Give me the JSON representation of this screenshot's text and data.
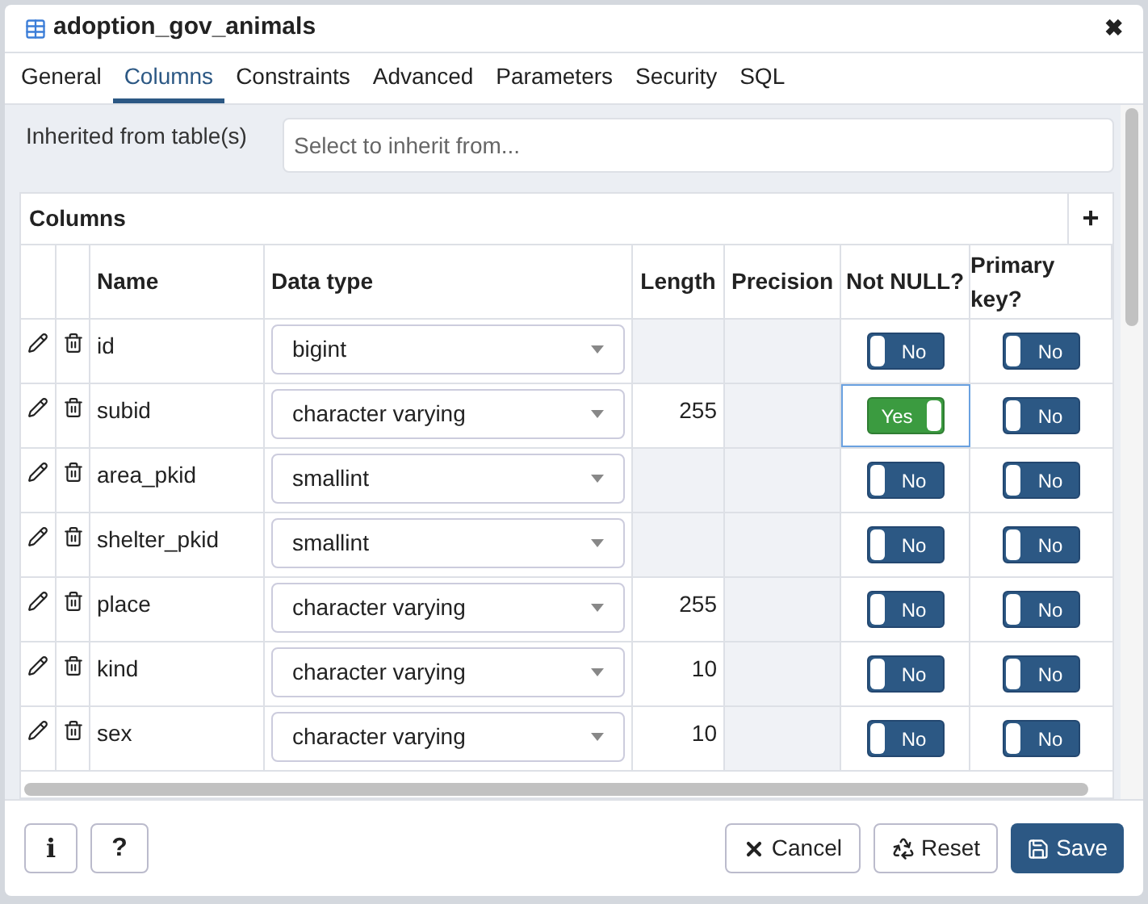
{
  "window": {
    "title": "adoption_gov_animals",
    "close": "✖"
  },
  "tabs": [
    {
      "label": "General",
      "selected": false
    },
    {
      "label": "Columns",
      "selected": true
    },
    {
      "label": "Constraints",
      "selected": false
    },
    {
      "label": "Advanced",
      "selected": false
    },
    {
      "label": "Parameters",
      "selected": false
    },
    {
      "label": "Security",
      "selected": false
    },
    {
      "label": "SQL",
      "selected": false
    }
  ],
  "inherit": {
    "label": "Inherited from table(s)",
    "placeholder": "Select to inherit from..."
  },
  "columns_panel": {
    "title": "Columns",
    "add": "+"
  },
  "table": {
    "columns": [
      "Name",
      "Data type",
      "Length",
      "Precision",
      "Not NULL?",
      "Primary key?"
    ],
    "rows": [
      {
        "name": "id",
        "type": "bigint",
        "length": "",
        "length_disabled": true,
        "not_null": {
          "label": "No",
          "on": false,
          "focused": false
        },
        "primary_key": {
          "label": "No",
          "on": false
        }
      },
      {
        "name": "subid",
        "type": "character varying",
        "length": "255",
        "length_disabled": false,
        "not_null": {
          "label": "Yes",
          "on": true,
          "focused": true
        },
        "primary_key": {
          "label": "No",
          "on": false
        }
      },
      {
        "name": "area_pkid",
        "type": "smallint",
        "length": "",
        "length_disabled": true,
        "not_null": {
          "label": "No",
          "on": false,
          "focused": false
        },
        "primary_key": {
          "label": "No",
          "on": false
        }
      },
      {
        "name": "shelter_pkid",
        "type": "smallint",
        "length": "",
        "length_disabled": true,
        "not_null": {
          "label": "No",
          "on": false,
          "focused": false
        },
        "primary_key": {
          "label": "No",
          "on": false
        }
      },
      {
        "name": "place",
        "type": "character varying",
        "length": "255",
        "length_disabled": false,
        "not_null": {
          "label": "No",
          "on": false,
          "focused": false
        },
        "primary_key": {
          "label": "No",
          "on": false
        }
      },
      {
        "name": "kind",
        "type": "character varying",
        "length": "10",
        "length_disabled": false,
        "not_null": {
          "label": "No",
          "on": false,
          "focused": false
        },
        "primary_key": {
          "label": "No",
          "on": false
        }
      },
      {
        "name": "sex",
        "type": "character varying",
        "length": "10",
        "length_disabled": false,
        "not_null": {
          "label": "No",
          "on": false,
          "focused": false
        },
        "primary_key": {
          "label": "No",
          "on": false
        }
      }
    ]
  },
  "footer": {
    "info": "i",
    "help": "?",
    "cancel": "Cancel",
    "reset": "Reset",
    "save": "Save"
  }
}
